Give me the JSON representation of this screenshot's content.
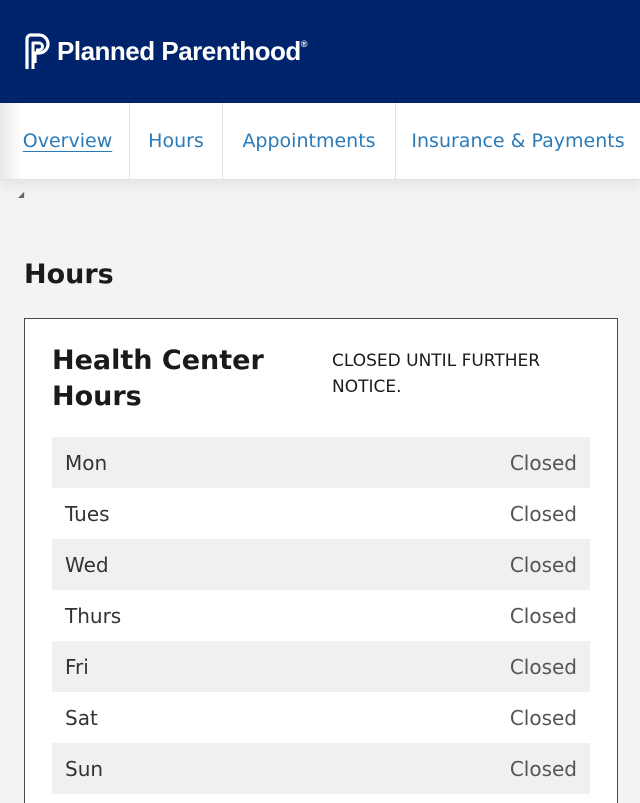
{
  "brand": {
    "name": "Planned Parenthood",
    "mark": "®"
  },
  "tabs": [
    {
      "label": "Overview",
      "active": true
    },
    {
      "label": "Hours",
      "active": false
    },
    {
      "label": "Appointments",
      "active": false
    },
    {
      "label": "Insurance & Payments",
      "active": false
    }
  ],
  "page": {
    "section_title": "Hours"
  },
  "hours_card": {
    "title": "Health Center Hours",
    "notice": "CLOSED UNTIL FURTHER NOTICE.",
    "rows": [
      {
        "day": "Mon",
        "status": "Closed"
      },
      {
        "day": "Tues",
        "status": "Closed"
      },
      {
        "day": "Wed",
        "status": "Closed"
      },
      {
        "day": "Thurs",
        "status": "Closed"
      },
      {
        "day": "Fri",
        "status": "Closed"
      },
      {
        "day": "Sat",
        "status": "Closed"
      },
      {
        "day": "Sun",
        "status": "Closed"
      }
    ]
  },
  "colors": {
    "header_bg": "#00246b",
    "tab_link": "#2b7bb8"
  }
}
